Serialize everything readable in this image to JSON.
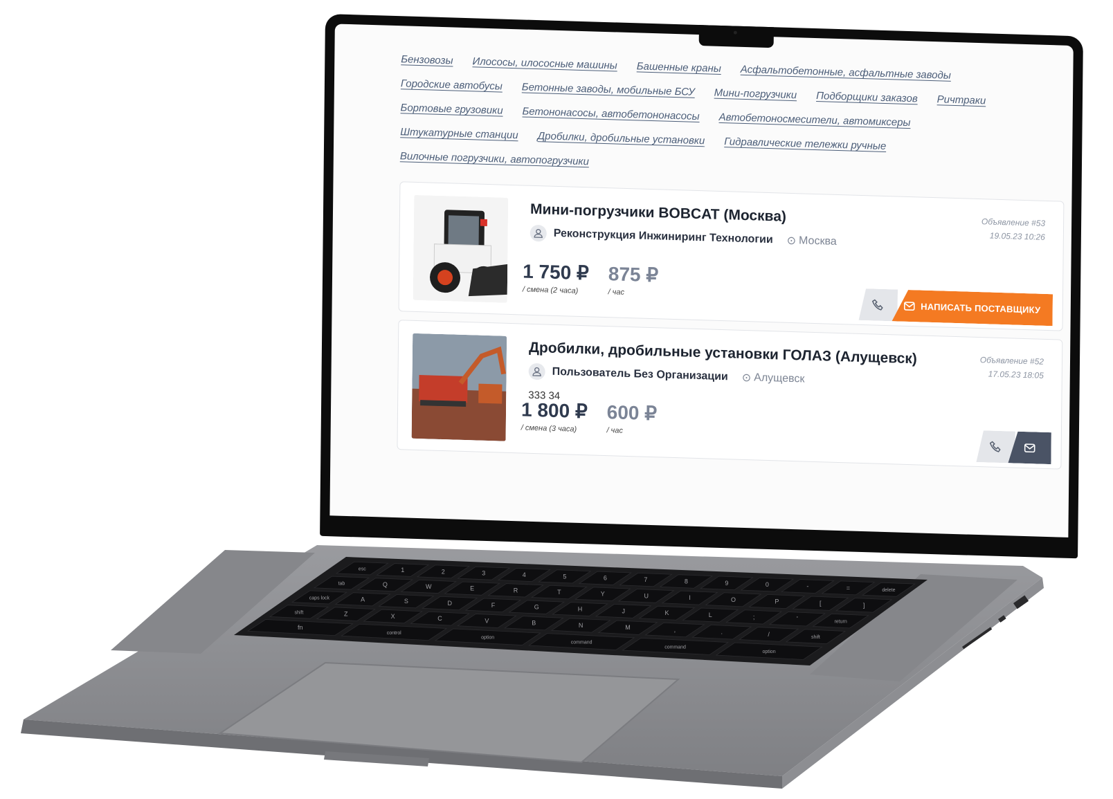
{
  "categories": [
    "Бензовозы",
    "Илососы, илососные машины",
    "Башенные краны",
    "Асфальтобетонные, асфальтные заводы",
    "Городские автобусы",
    "Бетонные заводы, мобильные БСУ",
    "Мини-погрузчики",
    "Подборщики заказов",
    "Ричтраки",
    "Бортовые грузовики",
    "Бетононасосы, автобетононасосы",
    "Автобетоносмесители, автомиксеры",
    "Штукатурные станции",
    "Дробилки, дробильные установки",
    "Гидравлические тележки ручные",
    "Вилочные погрузчики, автопогрузчики"
  ],
  "listings": [
    {
      "title": "Мини-погрузчики BOBCAT (Москва)",
      "seller": "Реконструкция Инжиниринг Технологии",
      "location": "Москва",
      "description": "",
      "ad_number": "Объявление #53",
      "date": "19.05.23 10:26",
      "price_main": "1 750 ₽",
      "price_main_caption": "/ смена (2 часа)",
      "price_hour": "875 ₽",
      "price_hour_caption": "/ час",
      "write_button": "НАПИСАТЬ ПОСТАВЩИКУ",
      "icons": {
        "phone": "phone-icon",
        "mail": "mail-icon",
        "user": "user-icon",
        "pin": "location-pin-icon"
      }
    },
    {
      "title": "Дробилки, дробильные установки ГОЛАЗ (Алущевск)",
      "seller": "Пользователь Без Организации",
      "location": "Алущевск",
      "description": "333 34",
      "ad_number": "Объявление #52",
      "date": "17.05.23 18:05",
      "price_main": "1 800 ₽",
      "price_main_caption": "/ смена (3 часа)",
      "price_hour": "600 ₽",
      "price_hour_caption": "/ час"
    }
  ],
  "keyboard": {
    "row_numbers": [
      "esc",
      "1",
      "2",
      "3",
      "4",
      "5",
      "6",
      "7",
      "8",
      "9",
      "0",
      "-",
      "=",
      "delete"
    ],
    "row_q": [
      "tab",
      "Q",
      "W",
      "E",
      "R",
      "T",
      "Y",
      "U",
      "I",
      "O",
      "P",
      "[",
      "]"
    ],
    "row_a": [
      "caps lock",
      "A",
      "S",
      "D",
      "F",
      "G",
      "H",
      "J",
      "K",
      "L",
      ";",
      "'",
      "return"
    ],
    "row_z": [
      "shift",
      "Z",
      "X",
      "C",
      "V",
      "B",
      "N",
      "M",
      ",",
      ".",
      "/",
      "shift"
    ],
    "row_bottom": [
      "fn",
      "control",
      "option",
      "command",
      "command",
      "option"
    ]
  },
  "colors": {
    "accent": "#f47a22",
    "text_dark": "#1d2430",
    "link": "#4b5d78",
    "aluminium": "#8e8f93"
  }
}
